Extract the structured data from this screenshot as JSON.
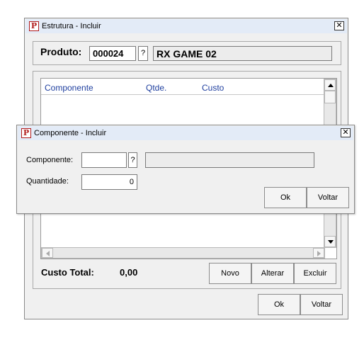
{
  "main_window": {
    "title": "Estrutura - Incluir",
    "produto_label": "Produto:",
    "produto_code": "000024",
    "lookup_label": "?",
    "produto_name": "RX GAME 02",
    "grid_columns": [
      "Componente",
      "Qtde.",
      "Custo"
    ],
    "custo_total_label": "Custo Total:",
    "custo_total_value": "0,00",
    "novo_label": "Novo",
    "alterar_label": "Alterar",
    "excluir_label": "Excluir",
    "ok_label": "Ok",
    "voltar_label": "Voltar"
  },
  "dialog": {
    "title": "Componente - Incluir",
    "componente_label": "Componente:",
    "componente_value": "",
    "lookup_label": "?",
    "componente_desc": "",
    "quantidade_label": "Quantidade:",
    "quantidade_value": "0",
    "ok_label": "Ok",
    "voltar_label": "Voltar"
  },
  "icons": {
    "app": "app-logo-icon",
    "close": "close-icon"
  }
}
